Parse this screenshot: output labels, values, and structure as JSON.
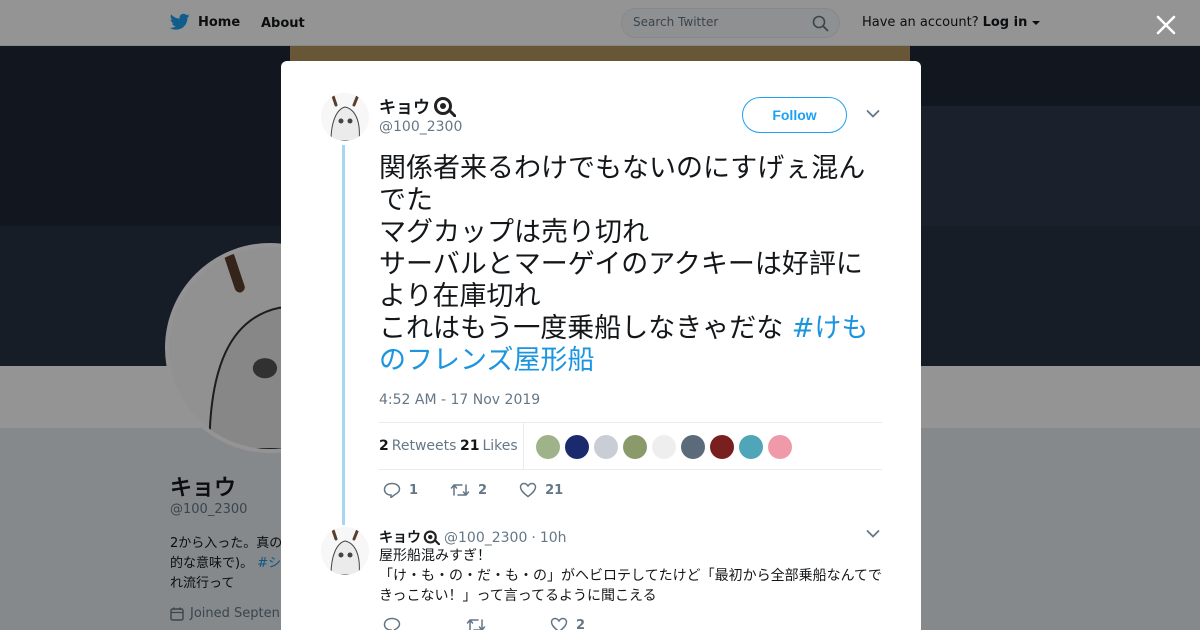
{
  "nav": {
    "home_label": "Home",
    "about_label": "About",
    "search_placeholder": "Search Twitter",
    "account_prompt": "Have an account?",
    "login_label": "Log in"
  },
  "profile": {
    "name": "キョウ",
    "handle": "@100_2300",
    "bio_lines": [
      "2から入った。真の",
      "的な意味で)。",
      "れ流行って"
    ],
    "bio_tag": "#シ",
    "joined": "Joined Septen"
  },
  "tweet": {
    "author_name": "キョウ",
    "author_handle": "@100_2300",
    "follow_label": "Follow",
    "text_lines": [
      "関係者来るわけでもないのにすげぇ混んでた",
      "マグカップは売り切れ",
      "サーバルとマーゲイのアクキーは好評により在庫切れ",
      "これはもう一度乗船しなきゃだな "
    ],
    "hashtag": "#けものフレンズ屋形船",
    "timestamp": "4:52 AM - 17 Nov 2019",
    "retweet_count": "2",
    "retweet_label": "Retweets",
    "like_count": "21",
    "like_label": "Likes",
    "action_reply_count": "1",
    "action_retweet_count": "2",
    "action_like_count": "21",
    "liker_colors": [
      "#9fb38a",
      "#1a2a6c",
      "#c9ced6",
      "#8a9a6b",
      "#eeeeee",
      "#5b6b7a",
      "#7a1f1f",
      "#4fa6b8",
      "#f09aa9"
    ]
  },
  "reply": {
    "author_name": "キョウ",
    "author_handle": "@100_2300",
    "separator": "·",
    "time": "10h",
    "text_lines": [
      "屋形船混みすぎ！",
      "「け・も・の・だ・も・の」がヘビロテしてたけど「最初から全部乗船なんてできっこない！」って言ってるように聞こえる"
    ],
    "like_count": "2"
  },
  "colors": {
    "accent": "#1da1f2",
    "link": "#1b95e0",
    "thread_line": "#a6d6f3",
    "muted": "#657786"
  }
}
